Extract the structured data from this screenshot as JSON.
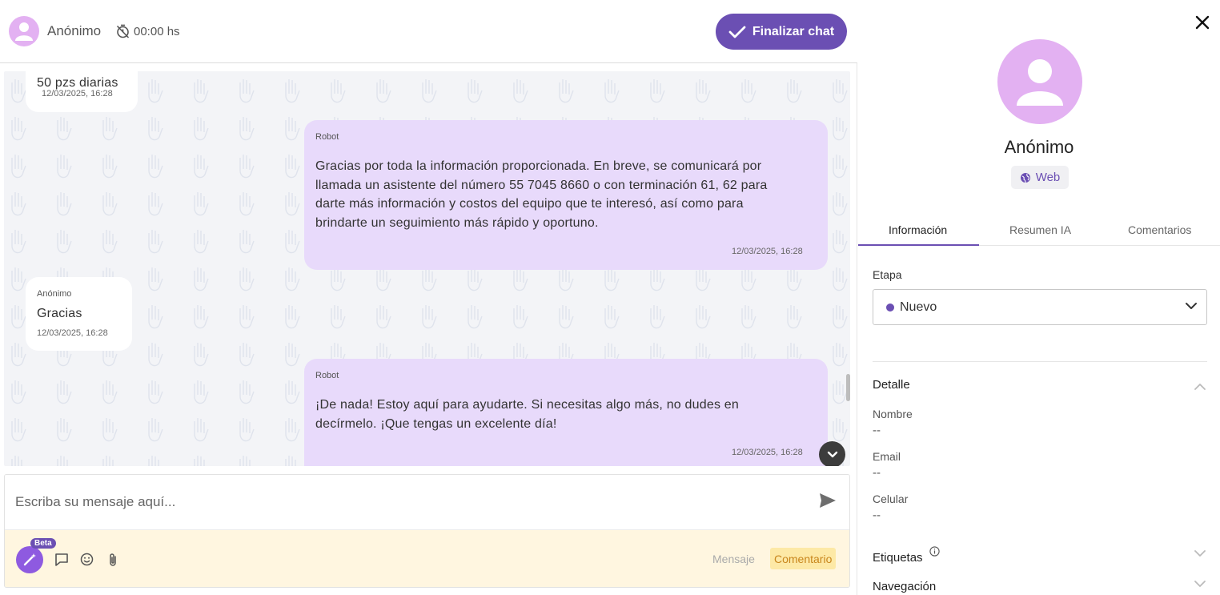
{
  "header": {
    "contact_name": "Anónimo",
    "timer": "00:00 hs",
    "finish_label": "Finalizar chat"
  },
  "messages": [
    {
      "direction": "in",
      "sender": "",
      "text": "50 pzs diarias",
      "time": "12/03/2025, 16:28"
    },
    {
      "direction": "out",
      "sender": "Robot",
      "lines": [
        "Gracias por toda la información proporcionada. En breve, se comunicará por",
        "llamada un asistente del número 55 7045 8660 o con terminación 61, 62 para",
        "darte más información y costos del equipo que te interesó, así como para",
        "brindarte un seguimiento más rápido y oportuno."
      ],
      "time": "12/03/2025, 16:28"
    },
    {
      "direction": "in",
      "sender": "Anónimo",
      "text": "Gracias",
      "time": "12/03/2025, 16:28"
    },
    {
      "direction": "out",
      "sender": "Robot",
      "lines": [
        "¡De nada! Estoy aquí para ayudarte. Si necesitas algo más, no dudes en",
        "decírmelo. ¡Que tengas un excelente día!"
      ],
      "time": "12/03/2025, 16:28"
    }
  ],
  "composer": {
    "placeholder": "Escriba su mensaje aquí...",
    "beta_label": "Beta",
    "mode_message": "Mensaje",
    "mode_comment": "Comentario"
  },
  "info": {
    "name": "Anónimo",
    "channel": "Web",
    "tabs": [
      "Información",
      "Resumen IA",
      "Comentarios"
    ],
    "stage_label": "Etapa",
    "stage_value": "Nuevo",
    "detail_title": "Detalle",
    "fields": [
      {
        "label": "Nombre",
        "value": "--"
      },
      {
        "label": "Email",
        "value": "--"
      },
      {
        "label": "Celular",
        "value": "--"
      }
    ],
    "tags_title": "Etiquetas",
    "nav_title": "Navegación"
  },
  "colors": {
    "accent": "#6b4fb3",
    "avatar": "#e3b1f2",
    "bubble_out": "#e8dafb",
    "comment_bg": "#fff6e0"
  }
}
